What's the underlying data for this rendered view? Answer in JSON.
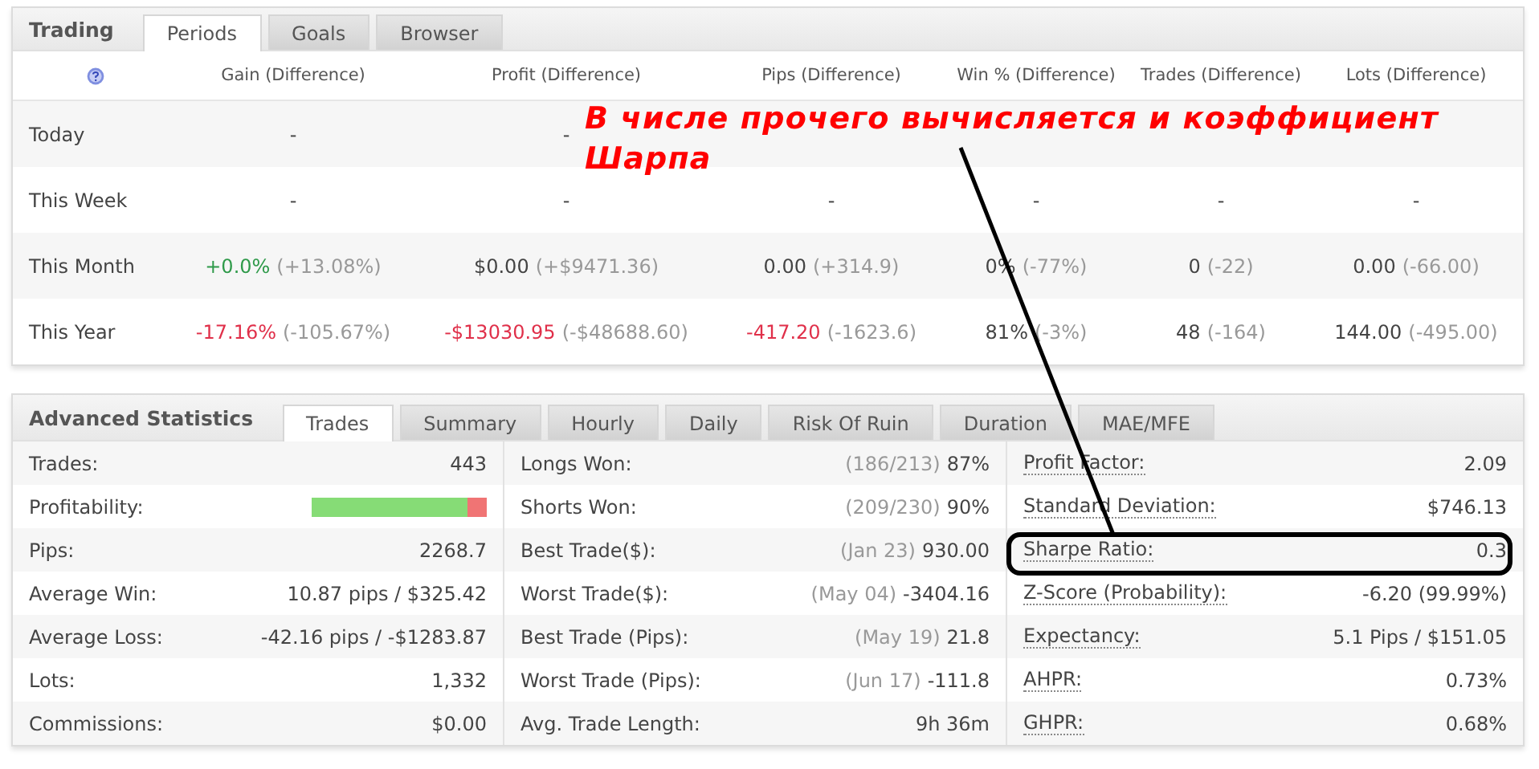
{
  "trading": {
    "title": "Trading",
    "tabs": [
      {
        "label": "Periods",
        "selected": true
      },
      {
        "label": "Goals",
        "selected": false
      },
      {
        "label": "Browser",
        "selected": false
      }
    ],
    "columns": [
      "Gain (Difference)",
      "Profit (Difference)",
      "Pips (Difference)",
      "Win % (Difference)",
      "Trades (Difference)",
      "Lots (Difference)"
    ],
    "rows": [
      {
        "label": "Today",
        "cells": [
          {
            "value": "-"
          },
          {
            "value": "-"
          }
        ]
      },
      {
        "label": "This Week",
        "cells": [
          {
            "value": "-"
          },
          {
            "value": "-"
          },
          {
            "value": "-"
          },
          {
            "value": "-"
          },
          {
            "value": "-"
          },
          {
            "value": "-"
          }
        ]
      },
      {
        "label": "This Month",
        "cells": [
          {
            "value": "+0.0%",
            "diff": "(+13.08%)",
            "color": "#2f9a4a"
          },
          {
            "value": "$0.00",
            "diff": "(+$9471.36)"
          },
          {
            "value": "0.00",
            "diff": "(+314.9)"
          },
          {
            "value": "0%",
            "diff": "(-77%)"
          },
          {
            "value": "0",
            "diff": "(-22)"
          },
          {
            "value": "0.00",
            "diff": "(-66.00)"
          }
        ]
      },
      {
        "label": "This Year",
        "cells": [
          {
            "value": "-17.16%",
            "diff": "(-105.67%)",
            "color": "#e0304a"
          },
          {
            "value": "-$13030.95",
            "diff": "(-$48688.60)",
            "color": "#e0304a"
          },
          {
            "value": "-417.20",
            "diff": "(-1623.6)",
            "color": "#e0304a"
          },
          {
            "value": "81%",
            "diff": "(-3%)"
          },
          {
            "value": "48",
            "diff": "(-164)"
          },
          {
            "value": "144.00",
            "diff": "(-495.00)"
          }
        ]
      }
    ]
  },
  "advanced": {
    "title": "Advanced Statistics",
    "tabs": [
      {
        "label": "Trades",
        "selected": true
      },
      {
        "label": "Summary",
        "selected": false
      },
      {
        "label": "Hourly",
        "selected": false
      },
      {
        "label": "Daily",
        "selected": false
      },
      {
        "label": "Risk Of Ruin",
        "selected": false
      },
      {
        "label": "Duration",
        "selected": false
      },
      {
        "label": "MAE/MFE",
        "selected": false
      }
    ],
    "columns": [
      [
        {
          "kind": "text",
          "label": "Trades:",
          "value": "443"
        },
        {
          "kind": "bar",
          "label": "Profitability:",
          "level": 0.89
        },
        {
          "kind": "text",
          "label": "Pips:",
          "value": "2268.7"
        },
        {
          "kind": "text",
          "label": "Average Win:",
          "value": "10.87 pips / $325.42"
        },
        {
          "kind": "text",
          "label": "Average Loss:",
          "value": "-42.16 pips / -$1283.87"
        },
        {
          "kind": "text",
          "label": "Lots:",
          "value": "1,332"
        },
        {
          "kind": "text",
          "label": "Commissions:",
          "value": "$0.00"
        }
      ],
      [
        {
          "kind": "text",
          "label": "Longs Won:",
          "note": "(186/213)",
          "value": "87%"
        },
        {
          "kind": "text",
          "label": "Shorts Won:",
          "note": "(209/230)",
          "value": "90%"
        },
        {
          "kind": "text",
          "label": "Best Trade($):",
          "note": "(Jan 23)",
          "value": "930.00"
        },
        {
          "kind": "text",
          "label": "Worst Trade($):",
          "note": "(May 04)",
          "value": "-3404.16"
        },
        {
          "kind": "text",
          "label": "Best Trade (Pips):",
          "note": "(May 19)",
          "value": "21.8"
        },
        {
          "kind": "text",
          "label": "Worst Trade (Pips):",
          "note": "(Jun 17)",
          "value": "-111.8"
        },
        {
          "kind": "text",
          "label": "Avg. Trade Length:",
          "value": "9h 36m"
        }
      ],
      [
        {
          "kind": "link",
          "label": "Profit Factor:",
          "value": "2.09"
        },
        {
          "kind": "link",
          "label": "Standard Deviation:",
          "value": "$746.13"
        },
        {
          "kind": "link",
          "label": "Sharpe Ratio:",
          "value": "0.3"
        },
        {
          "kind": "link",
          "label": "Z-Score (Probability):",
          "value": "-6.20 (99.99%)"
        },
        {
          "kind": "link",
          "label": "Expectancy:",
          "value": "5.1 Pips / $151.05"
        },
        {
          "kind": "link",
          "label": "AHPR:",
          "value": "0.73%"
        },
        {
          "kind": "link",
          "label": "GHPR:",
          "value": "0.68%"
        }
      ]
    ]
  },
  "annotation": {
    "text": "В числе прочего вычисляется и коэффициент Шарпа"
  }
}
